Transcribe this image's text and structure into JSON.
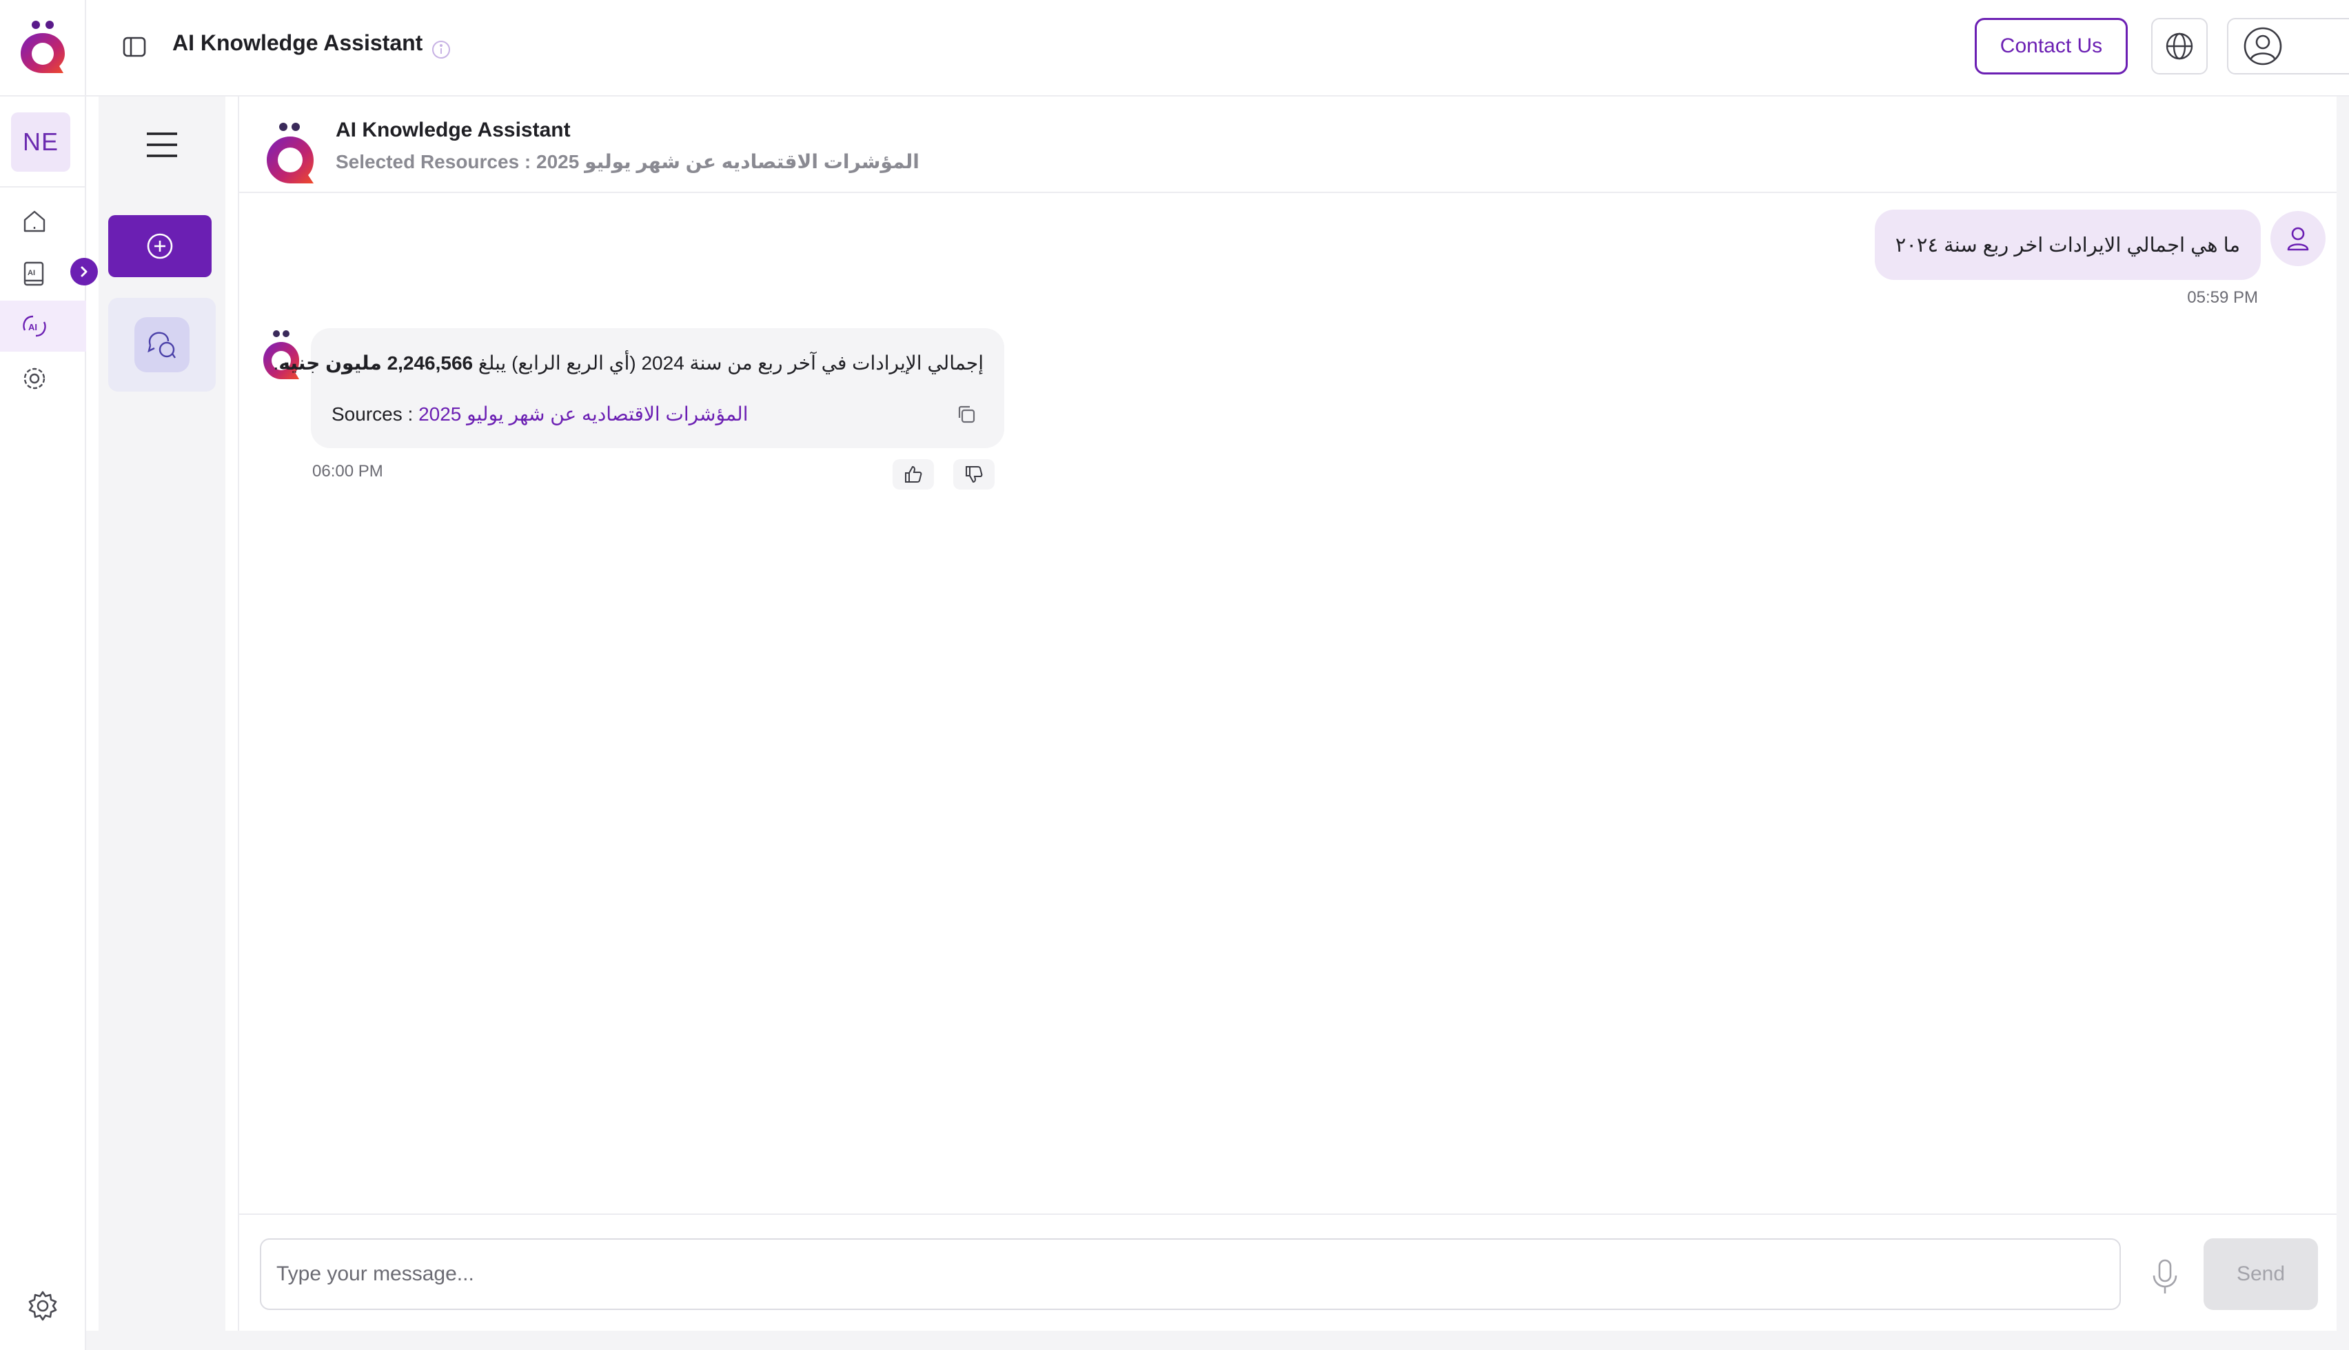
{
  "app": {
    "title": "AI Knowledge Assistant",
    "brand_color": "#6b1fb3"
  },
  "topbar": {
    "contact_label": "Contact Us",
    "icons": [
      "panel-toggle-icon",
      "info-icon",
      "globe-icon",
      "user-circle-icon",
      "hamburger-icon"
    ]
  },
  "rail": {
    "avatar_initials": "NE",
    "items": [
      {
        "name": "home",
        "icon": "home-icon"
      },
      {
        "name": "ai-book",
        "icon": "ai-book-icon"
      },
      {
        "name": "ai-assistant",
        "icon": "ai-assistant-icon",
        "active": true
      },
      {
        "name": "settings-gear",
        "icon": "gear-icon"
      }
    ]
  },
  "chat": {
    "header": {
      "title": "AI Knowledge Assistant",
      "subtitle": "Selected Resources : 2025 المؤشرات الاقتصاديه عن شهر يوليو"
    },
    "messages": [
      {
        "role": "user",
        "text": "ما هي اجمالي الايرادات اخر ربع سنة ٢٠٢٤",
        "time": "05:59 PM"
      },
      {
        "role": "assistant",
        "text_part1": "إجمالي الإيرادات في آخر ربع من سنة 2024 (أي الربع الرابع) يبلغ ",
        "text_bold": "2,246,566 مليون جنيه",
        "text_part2": ".",
        "sources_label": "Sources : ",
        "source_link": "2025 المؤشرات الاقتصاديه عن شهر يوليو",
        "time": "06:00 PM"
      }
    ],
    "composer": {
      "placeholder": "Type your message...",
      "send_label": "Send"
    }
  }
}
